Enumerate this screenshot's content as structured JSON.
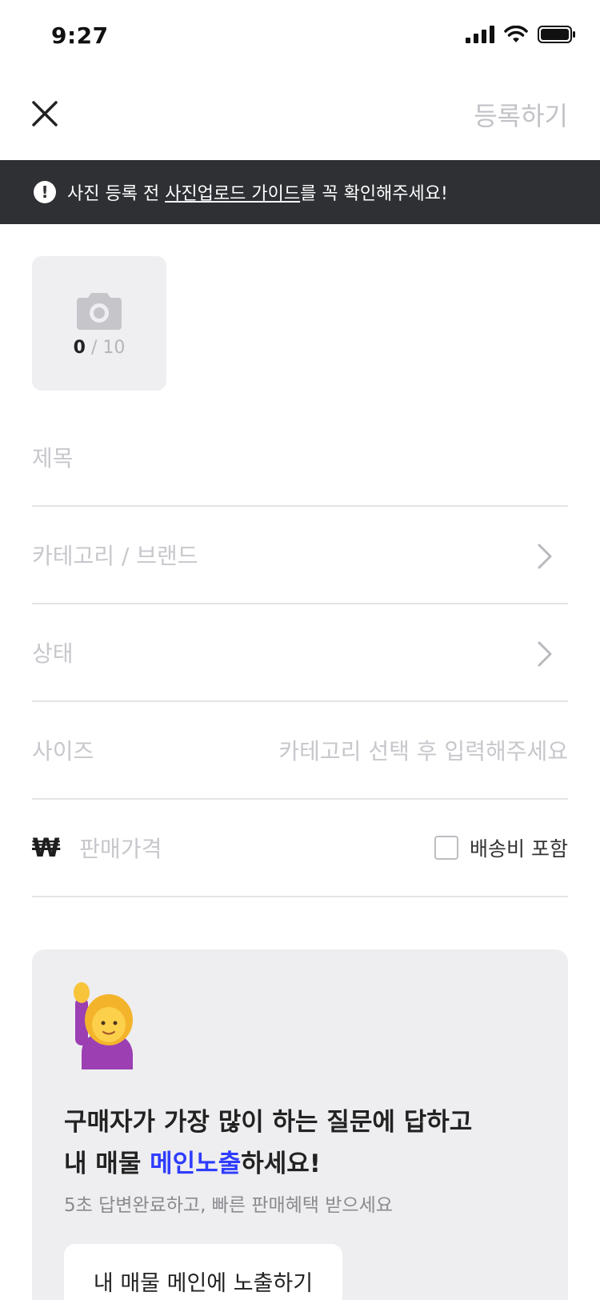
{
  "status_bar": {
    "time": "9:27"
  },
  "header": {
    "close_icon": "close-icon",
    "register_label": "등록하기"
  },
  "notice": {
    "prefix": "사진 등록 전 ",
    "link": "사진업로드 가이드",
    "suffix": "를 꼭 확인해주세요!"
  },
  "photo": {
    "current": "0",
    "separator": "/",
    "max": "10"
  },
  "fields": {
    "title_placeholder": "제목",
    "category_placeholder": "카테고리 / 브랜드",
    "condition_placeholder": "상태",
    "size_label": "사이즈",
    "size_hint": "카테고리 선택 후 입력해주세요",
    "currency": "₩",
    "price_placeholder": "판매가격",
    "shipping_label": "배송비 포함"
  },
  "promo": {
    "title_line1": "구매자가 가장 많이 하는 질문에 답하고",
    "title_line2_prefix": "내 매물 ",
    "title_line2_highlight": "메인노출",
    "title_line2_suffix": "하세요!",
    "subtitle": "5초 답변완료하고, 빠른 판매혜택 받으세요",
    "button_label": "내 매물 메인에 노출하기"
  },
  "colors": {
    "notice_bg": "#2f3034",
    "highlight": "#2f3dff",
    "card_bg": "#eeeef0",
    "placeholder": "#c7c7cc"
  }
}
